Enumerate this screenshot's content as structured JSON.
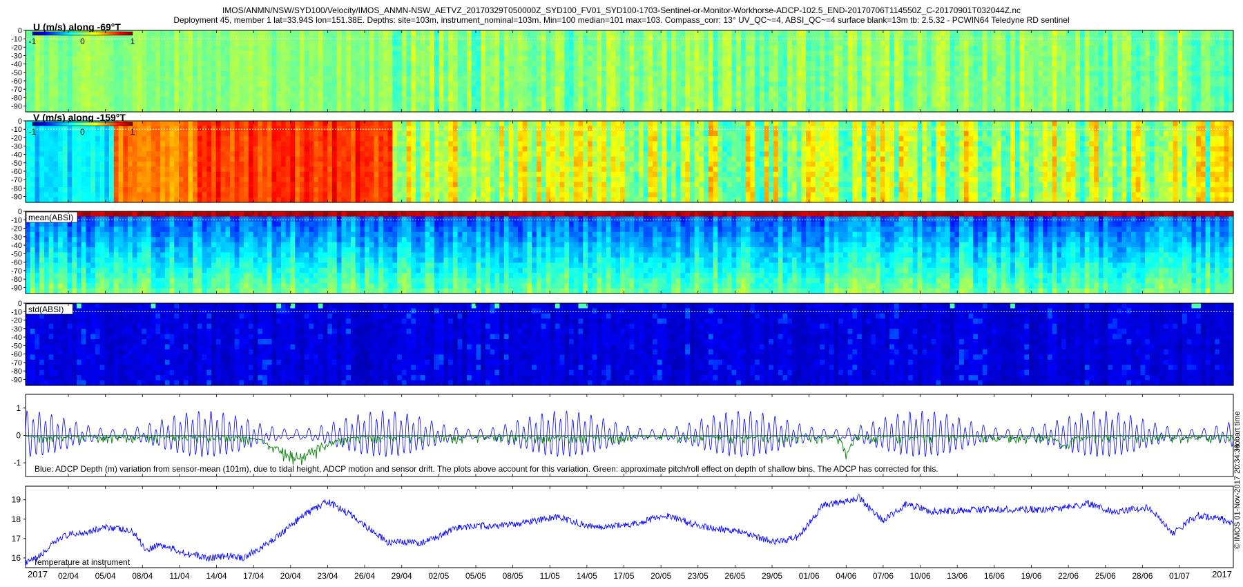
{
  "title": {
    "line1": "IMOS/ANMN/NSW/SYD100/Velocity/IMOS_ANMN-NSW_AETVZ_20170329T050000Z_SYD100_FV01_SYD100-1703-Sentinel-or-Monitor-Workhorse-ADCP-102.5_END-20170706T114550Z_C-20170901T032044Z.nc",
    "line2": "Deployment 45, member 1 lat=33.94S lon=151.38E. Depths: site=103m, instrument_nominal=103m. Min=100 median=101 max=103. Compass_corr: 13° UV_QC~=4, ABSI_QC~=4 surface blank=13m tb: 2.5.32 - PCWIN64 Teledyne RD sentinel"
  },
  "side_labels": {
    "hobart": "Hobart time",
    "imos": "© IMOS 01-Nov-2017 20:34:38"
  },
  "colors": {
    "jet": [
      "#00008f",
      "#0000ff",
      "#0080ff",
      "#00ffff",
      "#80ff80",
      "#ffff00",
      "#ff8000",
      "#ff0000",
      "#800000"
    ],
    "depth_line": "#0000ff",
    "pitch_line": "#008000",
    "temp_line": "#0000ff"
  },
  "chart_data": [
    {
      "type": "heatmap",
      "label": "U (m/s) along -69°T",
      "ytick_labels": [
        "0",
        "-10",
        "-20",
        "-30",
        "-40",
        "-50",
        "-60",
        "-70",
        "-80",
        "-90"
      ],
      "ylim": [
        -97,
        0
      ],
      "colorbar": {
        "min": -1,
        "max": 1,
        "tick_labels": [
          "-1",
          "0",
          "1"
        ]
      },
      "profile": {
        "value_range": [
          -1,
          1
        ],
        "segments": [
          {
            "end": 0.3,
            "mean": 0.02,
            "amp": 0.12
          },
          {
            "end": 1.0,
            "mean": 0.0,
            "amp": 0.2
          }
        ]
      }
    },
    {
      "type": "heatmap",
      "label": "V (m/s) along -159°T",
      "ytick_labels": [
        "0",
        "-10",
        "-20",
        "-30",
        "-40",
        "-50",
        "-60",
        "-70",
        "-80",
        "-90"
      ],
      "ylim": [
        -97,
        0
      ],
      "colorbar": {
        "min": -1,
        "max": 1,
        "tick_labels": [
          "-1",
          "0",
          "1"
        ]
      },
      "profile": {
        "value_range": [
          -1,
          1
        ],
        "segments": [
          {
            "end": 0.07,
            "mean": -0.3,
            "amp": 0.15
          },
          {
            "end": 0.14,
            "mean": 0.5,
            "amp": 0.15
          },
          {
            "end": 0.3,
            "mean": 0.65,
            "amp": 0.15
          },
          {
            "end": 0.5,
            "mean": 0.15,
            "amp": 0.3
          },
          {
            "end": 1.0,
            "mean": 0.1,
            "amp": 0.35
          }
        ]
      }
    },
    {
      "type": "heatmap",
      "label": "mean(ABSI)",
      "ytick_labels": [
        "0",
        "-10",
        "-20",
        "-30",
        "-40",
        "-50",
        "-60",
        "-70",
        "-80",
        "-90"
      ],
      "ylim": [
        -97,
        0
      ],
      "profile": {
        "value_range": [
          0,
          1
        ],
        "surface_band": "red",
        "depth_gradient": [
          0.2,
          0.5
        ]
      }
    },
    {
      "type": "heatmap",
      "label": "std(ABSI)",
      "ytick_labels": [
        "0",
        "-10",
        "-20",
        "-30",
        "-40",
        "-50",
        "-60",
        "-70",
        "-80",
        "-90"
      ],
      "ylim": [
        -97,
        0
      ],
      "profile": {
        "value_range": [
          0,
          1
        ],
        "mean": 0.04
      }
    },
    {
      "type": "line",
      "annotation": "Blue: ADCP Depth (m) variation from sensor-mean (101m), due to tidal height, ADCP motion and sensor drift. The plots above account for this variation. Green: approximate pitch/roll effect on depth of shallow bins. The ADCP has corrected for this.",
      "ytick_labels": [
        "1",
        "0",
        "-1"
      ],
      "yticks": [
        1,
        0,
        -1
      ],
      "ylim": [
        -1.5,
        1.5
      ],
      "series": [
        {
          "color": "blue",
          "kind": "tide",
          "amplitude": 0.75,
          "cycles": 197,
          "spring_neap_period_days": 14.7
        },
        {
          "color": "green",
          "kind": "pitch",
          "big_dip_center_x": 0.225,
          "big_dip_depth": -0.8
        }
      ]
    },
    {
      "type": "line",
      "label": "Temperature at instrument",
      "ytick_labels": [
        "19",
        "18",
        "17",
        "16"
      ],
      "yticks": [
        19,
        18,
        17,
        16
      ],
      "ylim": [
        15.5,
        19.7
      ],
      "series": [
        {
          "color": "blue",
          "anchors": [
            [
              0.0,
              15.7
            ],
            [
              0.01,
              16.0
            ],
            [
              0.03,
              17.1
            ],
            [
              0.07,
              17.6
            ],
            [
              0.09,
              17.3
            ],
            [
              0.1,
              16.4
            ],
            [
              0.11,
              16.7
            ],
            [
              0.13,
              16.3
            ],
            [
              0.15,
              16.0
            ],
            [
              0.17,
              16.1
            ],
            [
              0.18,
              16.0
            ],
            [
              0.2,
              16.7
            ],
            [
              0.23,
              18.2
            ],
            [
              0.25,
              18.9
            ],
            [
              0.27,
              18.2
            ],
            [
              0.3,
              16.8
            ],
            [
              0.33,
              16.8
            ],
            [
              0.36,
              17.6
            ],
            [
              0.4,
              17.7
            ],
            [
              0.44,
              18.1
            ],
            [
              0.47,
              17.6
            ],
            [
              0.5,
              17.7
            ],
            [
              0.53,
              18.2
            ],
            [
              0.56,
              17.6
            ],
            [
              0.59,
              17.4
            ],
            [
              0.62,
              16.8
            ],
            [
              0.64,
              17.1
            ],
            [
              0.66,
              18.7
            ],
            [
              0.69,
              19.1
            ],
            [
              0.71,
              17.9
            ],
            [
              0.73,
              18.8
            ],
            [
              0.75,
              18.4
            ],
            [
              0.8,
              18.5
            ],
            [
              0.85,
              18.5
            ],
            [
              0.88,
              18.8
            ],
            [
              0.9,
              18.4
            ],
            [
              0.93,
              18.6
            ],
            [
              0.95,
              17.3
            ],
            [
              0.97,
              18.2
            ],
            [
              0.99,
              18.0
            ],
            [
              1.0,
              17.8
            ]
          ]
        }
      ]
    }
  ],
  "time_axis": {
    "tick_labels": [
      "02/04",
      "05/04",
      "08/04",
      "11/04",
      "14/04",
      "17/04",
      "20/04",
      "23/04",
      "26/04",
      "29/04",
      "02/05",
      "05/05",
      "08/05",
      "11/05",
      "14/05",
      "17/05",
      "20/05",
      "23/05",
      "26/05",
      "29/05",
      "01/06",
      "04/06",
      "07/06",
      "10/06",
      "13/06",
      "16/06",
      "19/06",
      "22/06",
      "25/06",
      "28/06",
      "01/07"
    ],
    "start_label": "2017",
    "end_label": "2017"
  }
}
